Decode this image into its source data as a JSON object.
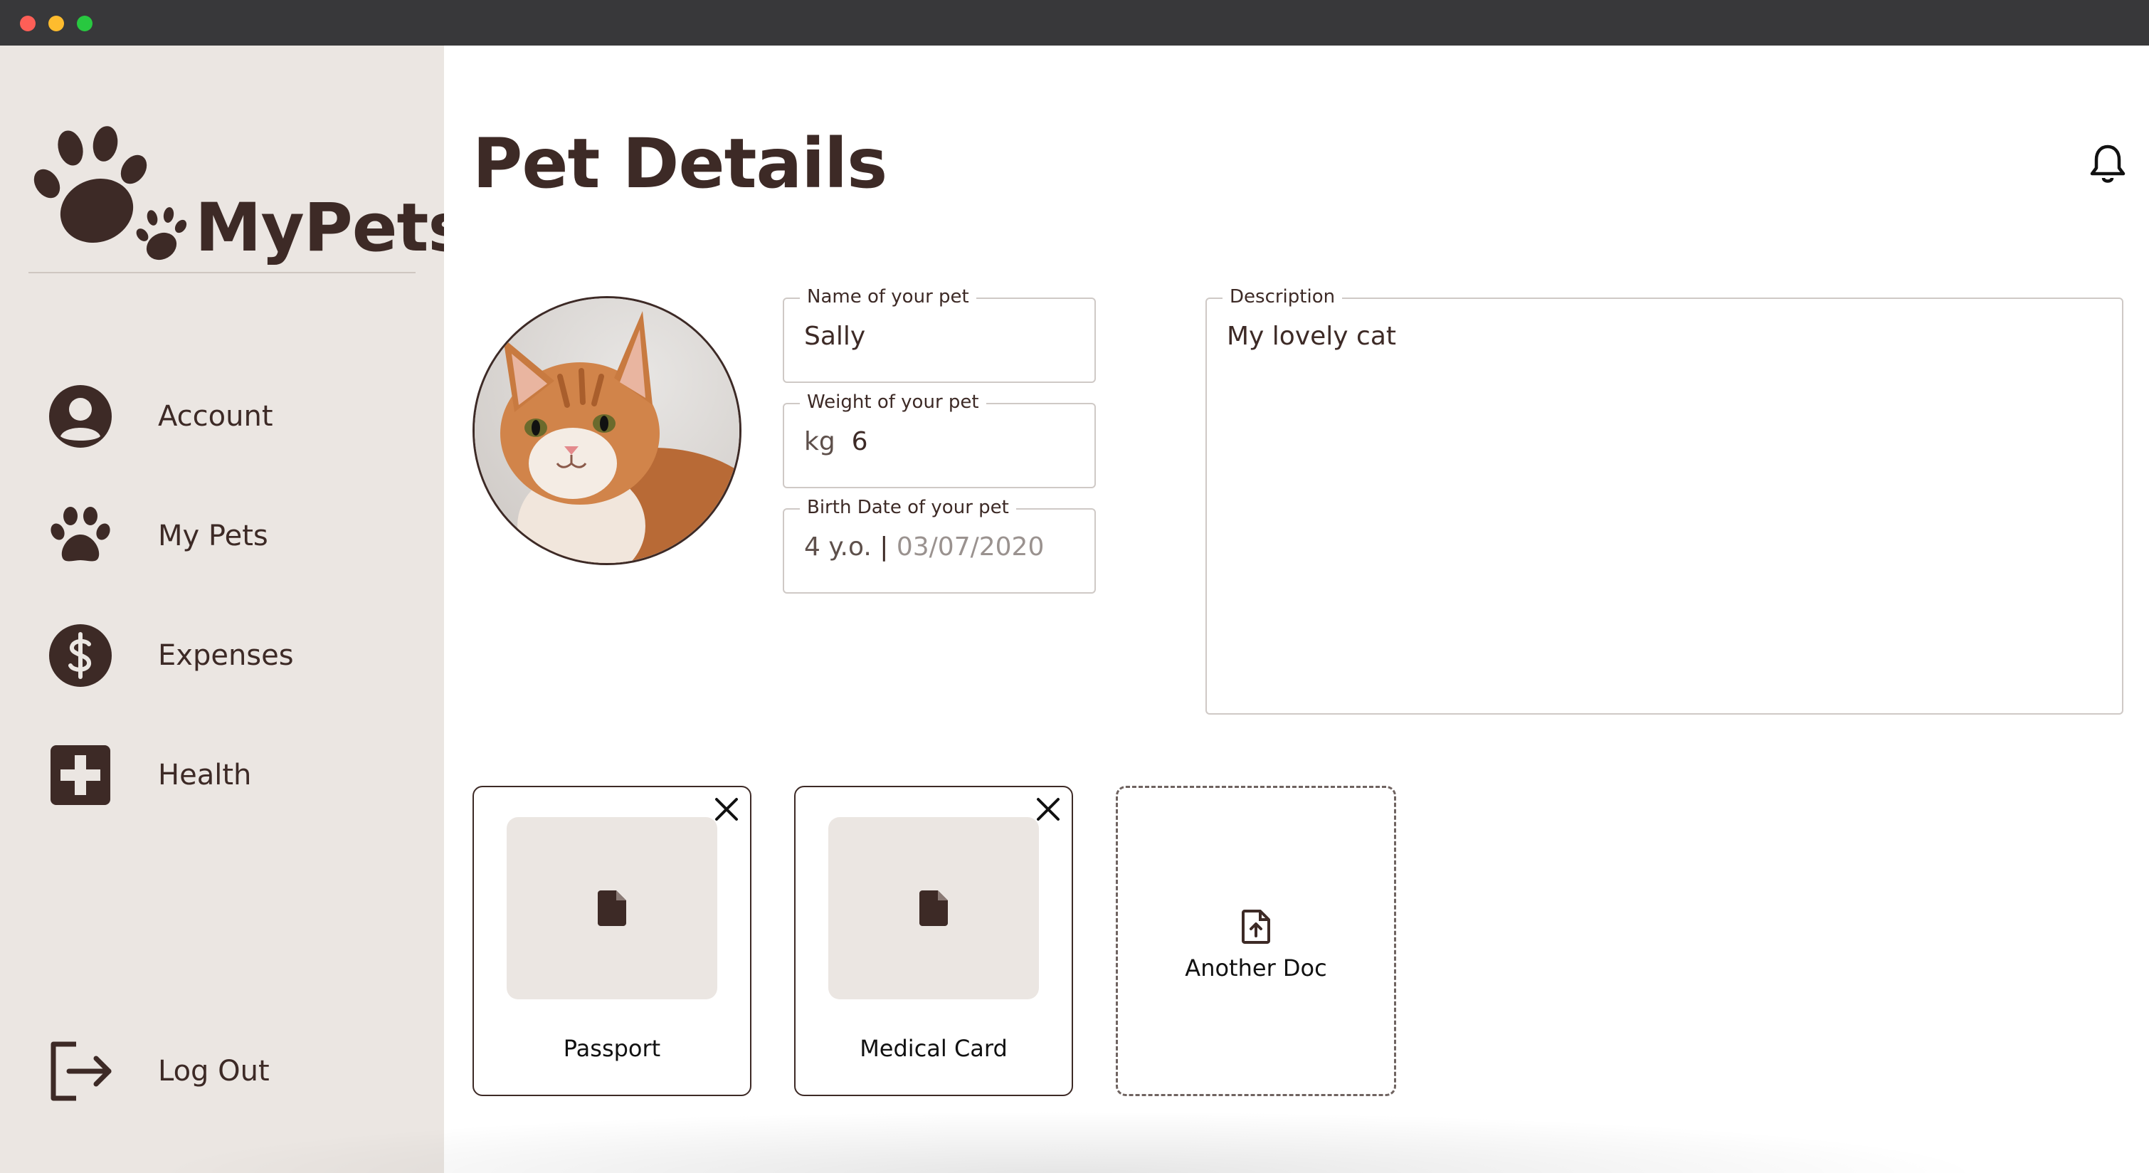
{
  "app": {
    "logo_text": "MyPets"
  },
  "sidebar": {
    "items": [
      {
        "label": "Account",
        "icon": "account-circle-icon"
      },
      {
        "label": "My Pets",
        "icon": "paw-icon"
      },
      {
        "label": "Expenses",
        "icon": "dollar-circle-icon"
      },
      {
        "label": "Health",
        "icon": "medical-cross-icon"
      }
    ],
    "logout_label": "Log Out"
  },
  "header": {
    "title": "Pet Details"
  },
  "form": {
    "name": {
      "label": "Name of your pet",
      "value": "Sally"
    },
    "weight": {
      "label": "Weight of your pet",
      "unit": "kg",
      "value": "6"
    },
    "birth_date": {
      "label": "Birth Date of your pet",
      "age": "4 y.o.",
      "separator": "|",
      "value": "03/07/2020"
    },
    "description": {
      "label": "Description",
      "value": "My lovely cat"
    }
  },
  "documents": {
    "items": [
      {
        "label": "Passport"
      },
      {
        "label": "Medical Card"
      }
    ],
    "add_label": "Another Doc"
  },
  "colors": {
    "brand": "#3d2a26",
    "sidebar_bg": "#ebe6e2",
    "field_border": "#cfc9c6"
  }
}
